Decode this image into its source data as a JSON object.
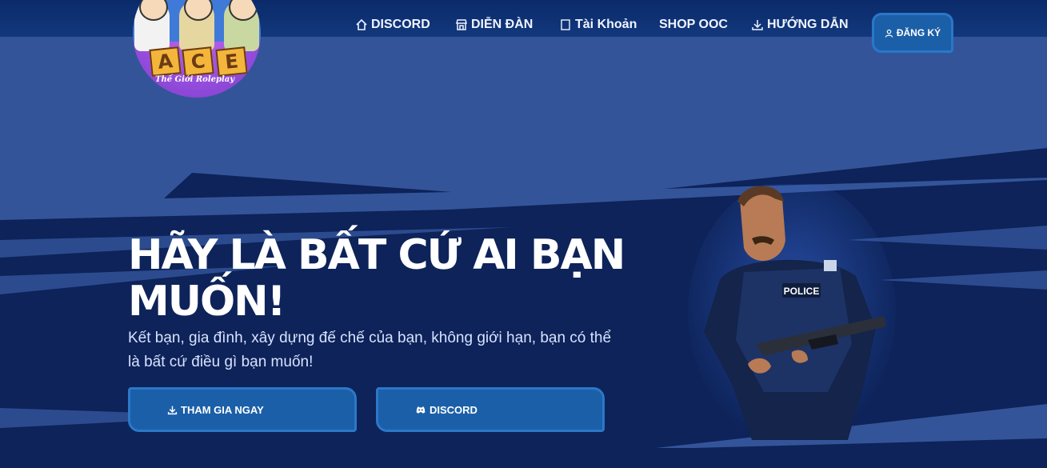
{
  "logo": {
    "letters": [
      "A",
      "C",
      "E"
    ],
    "tagline": "Thế Giới Roleplay"
  },
  "nav": {
    "items": [
      {
        "label": "DISCORD",
        "icon": "home-icon"
      },
      {
        "label": "DIỄN ĐÀN",
        "icon": "store-icon"
      },
      {
        "label": "Tài Khoản",
        "icon": "user-square-icon"
      },
      {
        "label": "SHOP OOC",
        "icon": ""
      },
      {
        "label": "HƯỚNG DẪN",
        "icon": "download-icon"
      }
    ],
    "signup": {
      "label": "ĐĂNG KÝ",
      "icon": "user-icon"
    }
  },
  "hero": {
    "title": "HÃY LÀ BẤT CỨ AI BẠN MUỐN!",
    "subtitle": "Kết bạn, gia đình, xây dựng đế chế của bạn, không giới hạn, bạn có thể là bất cứ điều gì bạn muốn!",
    "buttons": [
      {
        "label": "THAM GIA NGAY",
        "icon": "download-icon"
      },
      {
        "label": "DISCORD",
        "icon": "discord-icon"
      }
    ],
    "image_text": "POLICE"
  },
  "colors": {
    "background": "#34549a",
    "dark_navy": "#0b2257",
    "button": "#1b5fa8",
    "button_border": "#2c78c9"
  }
}
